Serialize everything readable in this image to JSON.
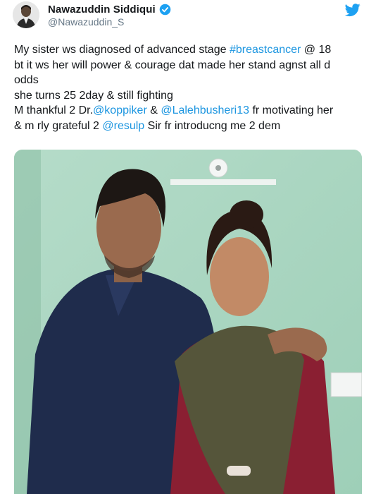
{
  "author": {
    "display_name": "Nawazuddin Siddiqui",
    "handle": "@Nawazuddin_S",
    "verified": true,
    "avatar_icon": "avatar-person-icon"
  },
  "platform_icon": "twitter-bird-icon",
  "tweet": {
    "line1_text": "My sister ws diagnosed of advanced stage ",
    "line1_hashtag": "#breastcancer",
    "line1_rest": " @ 18",
    "line2": "bt it ws her will power & courage dat made her stand agnst all d",
    "line3": "odds",
    "line4": "she turns 25 2day & still fighting",
    "line5_a": "M thankful 2 Dr.",
    "line5_mention1": "@koppiker",
    "line5_b": " & ",
    "line5_mention2": "@Lalehbusheri13",
    "line5_c": " fr motivating her",
    "line6_a": "& m rly grateful 2 ",
    "line6_mention": "@resulp",
    "line6_b": " Sir fr introducng me 2 dem"
  },
  "colors": {
    "link": "#1b95e0",
    "verified_badge": "#1da1f2",
    "twitter_bird": "#1da1f2",
    "text": "#14171a",
    "secondary_text": "#657786",
    "photo_wall": "#a8d4bf"
  }
}
